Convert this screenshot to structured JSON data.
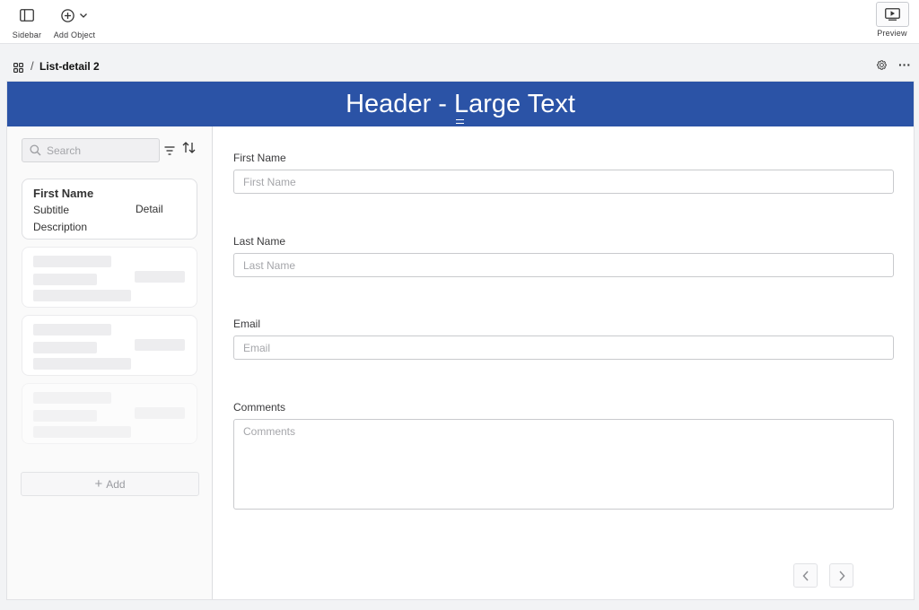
{
  "toolbar": {
    "sidebar_label": "Sidebar",
    "add_object_label": "Add Object",
    "preview_label": "Preview"
  },
  "breadcrumb": {
    "separator": "/",
    "title": "List-detail 2",
    "more": "···"
  },
  "header": {
    "text": "Header - Large Text",
    "color": "#2b53a6"
  },
  "list": {
    "search_placeholder": "Search",
    "card": {
      "title": "First Name",
      "subtitle": "Subtitle",
      "description": "Description",
      "detail": "Detail"
    },
    "add_label": "Add"
  },
  "form": {
    "fields": [
      {
        "label": "First Name",
        "placeholder": "First Name"
      },
      {
        "label": "Last Name",
        "placeholder": "Last Name"
      },
      {
        "label": "Email",
        "placeholder": "Email"
      },
      {
        "label": "Comments",
        "placeholder": "Comments"
      }
    ]
  },
  "icons": {
    "sidebar": "sidebar-icon",
    "add_object": "plus-circle-icon",
    "dropdown": "chevron-down-icon",
    "preview": "play-screen-icon",
    "grid": "grid-icon",
    "settings": "gear-icon",
    "search": "search-icon",
    "filter": "filter-icon",
    "sort": "sort-icon",
    "prev": "chevron-left-icon",
    "next": "chevron-right-icon"
  }
}
